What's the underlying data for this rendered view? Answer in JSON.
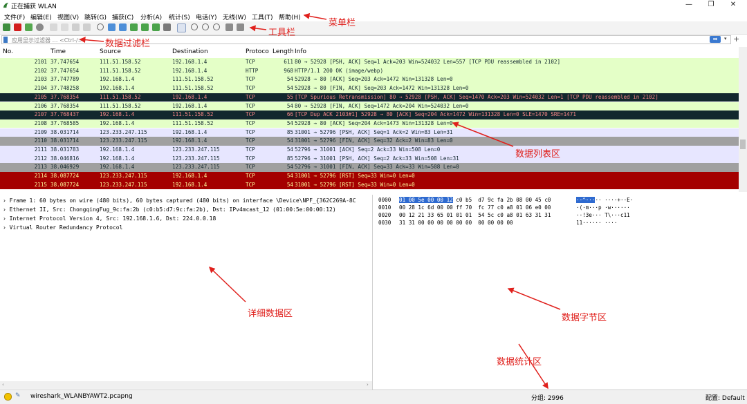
{
  "window": {
    "title": "正在捕获 WLAN",
    "controls": [
      "—",
      "❐",
      "✕"
    ]
  },
  "menu": [
    "文件(F)",
    "编辑(E)",
    "视图(V)",
    "跳转(G)",
    "捕获(C)",
    "分析(A)",
    "统计(S)",
    "电话(Y)",
    "无线(W)",
    "工具(T)",
    "帮助(H)"
  ],
  "filter": {
    "placeholder": "应用显示过滤器 … <Ctrl-/>",
    "apply_label": "➡",
    "dropdown": "▾",
    "add": "+"
  },
  "columns": [
    "No.",
    "Time",
    "Source",
    "Destination",
    "Protoco",
    "Length",
    "Info"
  ],
  "packets": [
    {
      "no": "2101",
      "time": "37.747654",
      "src": "111.51.158.52",
      "dst": "192.168.1.4",
      "proto": "TCP",
      "len": "611",
      "info": "80 → 52928 [PSH, ACK] Seq=1 Ack=203 Win=524032 Len=557 [TCP PDU reassembled in 2102]",
      "bg": "#e4ffc7",
      "fg": "#12272e"
    },
    {
      "no": "2102",
      "time": "37.747654",
      "src": "111.51.158.52",
      "dst": "192.168.1.4",
      "proto": "HTTP",
      "len": "968",
      "info": "HTTP/1.1 200 OK  (image/webp)",
      "bg": "#e4ffc7",
      "fg": "#12272e"
    },
    {
      "no": "2103",
      "time": "37.747789",
      "src": "192.168.1.4",
      "dst": "111.51.158.52",
      "proto": "TCP",
      "len": "54",
      "info": "52928 → 80 [ACK] Seq=203 Ack=1472 Win=131328 Len=0",
      "bg": "#e4ffc7",
      "fg": "#12272e"
    },
    {
      "no": "2104",
      "time": "37.748258",
      "src": "192.168.1.4",
      "dst": "111.51.158.52",
      "proto": "TCP",
      "len": "54",
      "info": "52928 → 80 [FIN, ACK] Seq=203 Ack=1472 Win=131328 Len=0",
      "bg": "#e4ffc7",
      "fg": "#12272e"
    },
    {
      "no": "2105",
      "time": "37.768354",
      "src": "111.51.158.52",
      "dst": "192.168.1.4",
      "proto": "TCP",
      "len": "55",
      "info": "[TCP Spurious Retransmission] 80 → 52928 [PSH, ACK] Seq=1470 Ack=203 Win=524032 Len=1 [TCP PDU reassembled in 2102]",
      "bg": "#12272e",
      "fg": "#f78787"
    },
    {
      "no": "2106",
      "time": "37.768354",
      "src": "111.51.158.52",
      "dst": "192.168.1.4",
      "proto": "TCP",
      "len": "54",
      "info": "80 → 52928 [FIN, ACK] Seq=1472 Ack=204 Win=524032 Len=0",
      "bg": "#e4ffc7",
      "fg": "#12272e"
    },
    {
      "no": "2107",
      "time": "37.768437",
      "src": "192.168.1.4",
      "dst": "111.51.158.52",
      "proto": "TCP",
      "len": "66",
      "info": "[TCP Dup ACK 2103#1] 52928 → 80 [ACK] Seq=204 Ack=1472 Win=131328 Len=0 SLE=1470 SRE=1471",
      "bg": "#12272e",
      "fg": "#f78787"
    },
    {
      "no": "2108",
      "time": "37.768585",
      "src": "192.168.1.4",
      "dst": "111.51.158.52",
      "proto": "TCP",
      "len": "54",
      "info": "52928 → 80 [ACK] Seq=204 Ack=1473 Win=131328 Len=0",
      "bg": "#e4ffc7",
      "fg": "#12272e"
    },
    {
      "no": "2109",
      "time": "38.031714",
      "src": "123.233.247.115",
      "dst": "192.168.1.4",
      "proto": "TCP",
      "len": "85",
      "info": "31001 → 52796 [PSH, ACK] Seq=1 Ack=2 Win=83 Len=31",
      "bg": "#e7e6ff",
      "fg": "#12272e"
    },
    {
      "no": "2110",
      "time": "38.031714",
      "src": "123.233.247.115",
      "dst": "192.168.1.4",
      "proto": "TCP",
      "len": "54",
      "info": "31001 → 52796 [FIN, ACK] Seq=32 Ack=2 Win=83 Len=0",
      "bg": "#a0a0a0",
      "fg": "#12272e"
    },
    {
      "no": "2111",
      "time": "38.031783",
      "src": "192.168.1.4",
      "dst": "123.233.247.115",
      "proto": "TCP",
      "len": "54",
      "info": "52796 → 31001 [ACK] Seq=2 Ack=33 Win=508 Len=0",
      "bg": "#e7e6ff",
      "fg": "#12272e"
    },
    {
      "no": "2112",
      "time": "38.046816",
      "src": "192.168.1.4",
      "dst": "123.233.247.115",
      "proto": "TCP",
      "len": "85",
      "info": "52796 → 31001 [PSH, ACK] Seq=2 Ack=33 Win=508 Len=31",
      "bg": "#e7e6ff",
      "fg": "#12272e"
    },
    {
      "no": "2113",
      "time": "38.046929",
      "src": "192.168.1.4",
      "dst": "123.233.247.115",
      "proto": "TCP",
      "len": "54",
      "info": "52796 → 31001 [FIN, ACK] Seq=33 Ack=33 Win=508 Len=0",
      "bg": "#a0a0a0",
      "fg": "#12272e"
    },
    {
      "no": "2114",
      "time": "38.087724",
      "src": "123.233.247.115",
      "dst": "192.168.1.4",
      "proto": "TCP",
      "len": "54",
      "info": "31001 → 52796 [RST] Seq=33 Win=0 Len=0",
      "bg": "#a40000",
      "fg": "#fffc9c"
    },
    {
      "no": "2115",
      "time": "38.087724",
      "src": "123.233.247.115",
      "dst": "192.168.1.4",
      "proto": "TCP",
      "len": "54",
      "info": "31001 → 52796 [RST] Seq=33 Win=0 Len=0",
      "bg": "#a40000",
      "fg": "#fffc9c"
    }
  ],
  "details": [
    "Frame 1: 60 bytes on wire (480 bits), 60 bytes captured (480 bits) on interface \\Device\\NPF_{362C269A-8C",
    "Ethernet II, Src: ChongqingFug_9c:fa:2b (c0:b5:d7:9c:fa:2b), Dst: IPv4mcast_12 (01:00:5e:00:00:12)",
    "Internet Protocol Version 4, Src: 192.168.1.6, Dst: 224.0.0.18",
    "Virtual Router Redundancy Protocol"
  ],
  "bytes": [
    {
      "offset": "0000",
      "hex_sel": "01 00 5e 00 00 12",
      "hex_rest": " c0 b5  d7 9c fa 2b 08 00 45 c0",
      "ascii_sel": "··^···",
      "ascii_rest": "·· ····+··E·"
    },
    {
      "offset": "0010",
      "hex_sel": "",
      "hex_rest": "00 28 1c 6d 00 00 ff 70  fc 77 c0 a8 01 06 e0 00",
      "ascii_sel": "",
      "ascii_rest": "·(·m···p ·w······"
    },
    {
      "offset": "0020",
      "hex_sel": "",
      "hex_rest": "00 12 21 33 65 01 01 01  54 5c c0 a8 01 63 31 31",
      "ascii_sel": "",
      "ascii_rest": "··!3e··· T\\···c11"
    },
    {
      "offset": "0030",
      "hex_sel": "",
      "hex_rest": "31 31 00 00 00 00 00 00  00 00 00 00",
      "ascii_sel": "",
      "ascii_rest": "11······ ····"
    }
  ],
  "status": {
    "file": "wireshark_WLANBYAWT2.pcapng",
    "packets": "分组: 2996",
    "profile": "配置: Default"
  },
  "annotations": {
    "menubar": "菜单栏",
    "toolbar": "工具栏",
    "filterbar": "数据过滤栏",
    "packet_list": "数据列表区",
    "details": "详细数据区",
    "bytes": "数据字节区",
    "stats": "数据统计区"
  },
  "colors": {
    "annotation_red": "#e0201c",
    "selection_blue": "#2e6ad0"
  }
}
